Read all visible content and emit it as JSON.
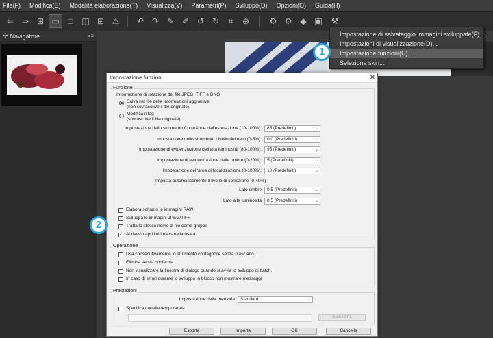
{
  "menubar": {
    "items": [
      "File(F)",
      "Modifica(E)",
      "Modalità elaborazione(T)",
      "Visualizza(V)",
      "Parametri(P)",
      "Sviluppo(D)",
      "Opzioni(O)",
      "Guida(H)"
    ]
  },
  "left_panel": {
    "title": "Navigatore"
  },
  "dropdown": {
    "items": [
      "Impostazione di salvataggio immagini sviluppate(F)...",
      "Impostazioni di visualizzazione(D)...",
      "Impostazione funzioni(U)...",
      "Seleziona skin..."
    ],
    "highlighted_index": 2
  },
  "markers": {
    "one": "1",
    "two": "2"
  },
  "dialog": {
    "title": "Impostazione funzioni",
    "close": "✕",
    "funzione": {
      "title": "Funzione",
      "rotation_header": "Informazione di rotazione dei file JPEG, TIFF e DNG",
      "radio1_line1": "Salva nel file delle informazioni aggiuntive",
      "radio1_line2": "(non sovrascrive il file originale)",
      "radio2_line1": "Modifica il tag",
      "radio2_line2": "(sovrascrive il file originale)",
      "settings": [
        {
          "label": "Impostazione dello strumento Correzione dell'esposizione (10-100%):",
          "value": "85 (Predefiniti)"
        },
        {
          "label": "Impostazione dello strumento Livello del nero (0-5%):",
          "value": "0.0 (Predefiniti)"
        },
        {
          "label": "Impostazione di evidenziazione dell'alta luminosità (80-100%):",
          "value": "95 (Predefiniti)"
        },
        {
          "label": "Impostazione di evidenziazione delle ombre (0-20%):",
          "value": "5 (Predefiniti)"
        },
        {
          "label": "Impostazione dell'area di focalizzazione (0-100%):",
          "value": "10 (Predefiniti)"
        }
      ],
      "auto_header": "Imposta automaticamente il livello di correzione (0-40%)",
      "ombre_label": "Lato ombre",
      "ombre_value": "0.5 (Predefiniti)",
      "alta_label": "Lato alta luminosità",
      "alta_value": "0.5 (Predefiniti)",
      "checkboxes": [
        {
          "label": "Elabora soltanto le immagini RAW",
          "checked": false
        },
        {
          "label": "Sviluppa le immagini JPEG/TIFF",
          "checked": true
        },
        {
          "label": "Tratta lo stesso nome di file come gruppo",
          "checked": true
        },
        {
          "label": "Al riavvio apri l'ultima cartella usata",
          "checked": true
        }
      ]
    },
    "operazione": {
      "title": "Operazione",
      "checkboxes": [
        "Usa consecutivamente lo strumento contagocce senza rilasciarlo",
        "Elimina senza conferma",
        "Non visualizzare la finestra di dialogo quando si avvia lo sviluppo di batch.",
        "In caso di errori durante lo sviluppo in blocco non mostrare messaggi"
      ]
    },
    "prestazioni": {
      "title": "Prestazioni",
      "memory_label": "Impostazione della memoria",
      "memory_value": "Standard",
      "temp_label": "Specifica cartella temporanea",
      "browse": "Seleziona"
    },
    "buttons": {
      "export": "Esporta",
      "import": "Importa",
      "ok": "OK",
      "cancel": "Cancella"
    }
  }
}
